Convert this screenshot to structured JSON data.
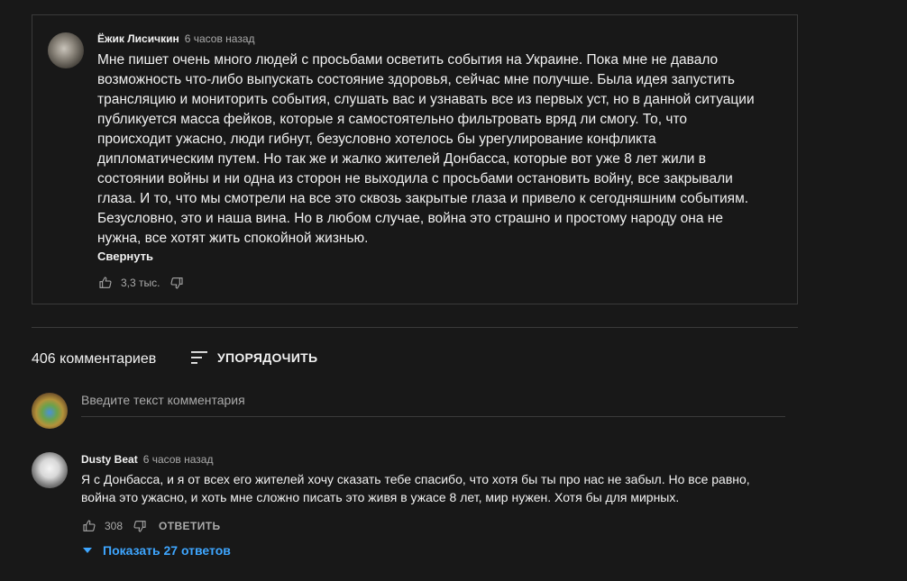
{
  "pinned_comment": {
    "author": "Ёжик Лисичкин",
    "time": "6 часов назад",
    "text": "Мне пишет очень много людей с просьбами осветить события на Украине. Пока мне не давало возможность что-либо выпускать состояние здоровья, сейчас мне получше. Была идея запустить трансляцию и мониторить события, слушать вас и узнавать все из первых уст, но в данной ситуации публикуется масса фейков, которые я самостоятельно фильтровать вряд ли смогу. То, что происходит ужасно, люди гибнут, безусловно хотелось бы урегулирование конфликта дипломатическим путем. Но так же и жалко жителей Донбасса, которые вот уже 8 лет жили в состоянии войны и ни одна из сторон не выходила с просьбами остановить войну, все закрывали глаза. И то, что мы смотрели на все это сквозь закрытые глаза и привело к сегодняшним событиям. Безусловно, это и наша вина. Но в любом случае, война это страшно и простому народу она не нужна, все хотят жить спокойной жизнью.",
    "collapse_label": "Свернуть",
    "likes": "3,3 тыс."
  },
  "comments_header": {
    "count_label": "406 комментариев",
    "sort_label": "УПОРЯДОЧИТЬ"
  },
  "new_comment": {
    "placeholder": "Введите текст комментария"
  },
  "comment": {
    "author": "Dusty Beat",
    "time": "6 часов назад",
    "text": "Я с Донбасса, и я от всех его жителей хочу сказать тебе спасибо, что хотя бы ты про нас не забыл. Но все равно, война это ужасно, и хоть мне сложно писать это живя в ужасе 8 лет, мир нужен. Хотя бы для мирных.",
    "likes": "308",
    "reply_label": "ОТВЕТИТЬ",
    "show_replies_label": "Показать 27 ответов"
  },
  "colors": {
    "background": "#181818",
    "link_blue": "#3ea6ff",
    "secondary_text": "#aaaaaa"
  }
}
